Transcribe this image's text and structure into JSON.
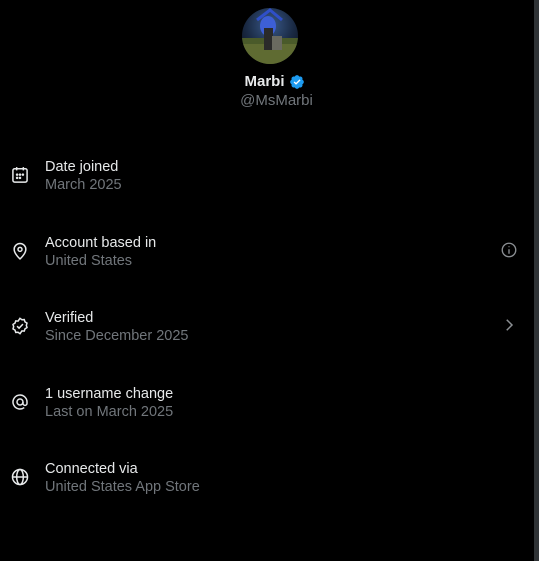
{
  "profile": {
    "display_name": "Marbi",
    "handle": "@MsMarbi",
    "verified": true
  },
  "about_items": [
    {
      "icon": "calendar-icon",
      "title": "Date joined",
      "subtitle": "March 2025"
    },
    {
      "icon": "location-pin-icon",
      "title": "Account based in",
      "subtitle": "United States",
      "trailing_icon": "info-icon"
    },
    {
      "icon": "verified-check-icon",
      "title": "Verified",
      "subtitle": "Since December 2025",
      "trailing_icon": "chevron-right-icon"
    },
    {
      "icon": "at-sign-icon",
      "title": "1 username change",
      "subtitle": "Last on March 2025"
    },
    {
      "icon": "globe-icon",
      "title": "Connected via",
      "subtitle": "United States App Store"
    }
  ],
  "colors": {
    "background": "#000000",
    "primary_text": "#e7e9ea",
    "secondary_text": "#71767b",
    "verified_blue": "#1d9bf0"
  }
}
